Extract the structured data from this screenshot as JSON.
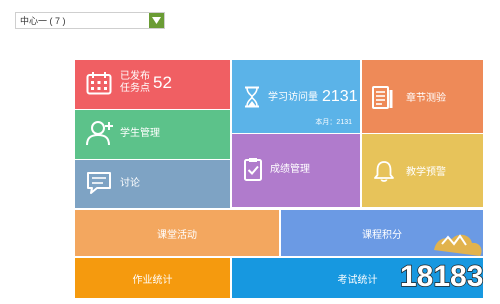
{
  "center_select": {
    "value": "中心一 ( 7 )"
  },
  "tiles": {
    "tasks": {
      "line1": "已发布",
      "line2": "任务点",
      "count": "52"
    },
    "visits": {
      "label": "学习访问量",
      "count": "2131",
      "sub": "本月：2131"
    },
    "chapter": {
      "label": "章节测验"
    },
    "student": {
      "label": "学生管理"
    },
    "grade": {
      "label": "成绩管理"
    },
    "warning": {
      "label": "教学预警"
    },
    "discuss": {
      "label": "讨论"
    },
    "class_activity": {
      "label": "课堂活动"
    },
    "course_points": {
      "label": "课程积分"
    },
    "homework": {
      "label": "作业统计"
    },
    "exam": {
      "label": "考试统计"
    }
  },
  "watermark": {
    "text": "18183"
  },
  "colors": {
    "tasks": "#f05f63",
    "visits": "#5bb3e8",
    "chapter": "#ee8a58",
    "student": "#5cc28a",
    "grade": "#b07bcc",
    "warning": "#e7c35a",
    "discuss": "#7ea3c4",
    "class_activity": "#f3a75f",
    "course_points": "#6b9ae4",
    "homework": "#f59a0e",
    "exam": "#1798e0",
    "select_button": "#6a9c34"
  }
}
